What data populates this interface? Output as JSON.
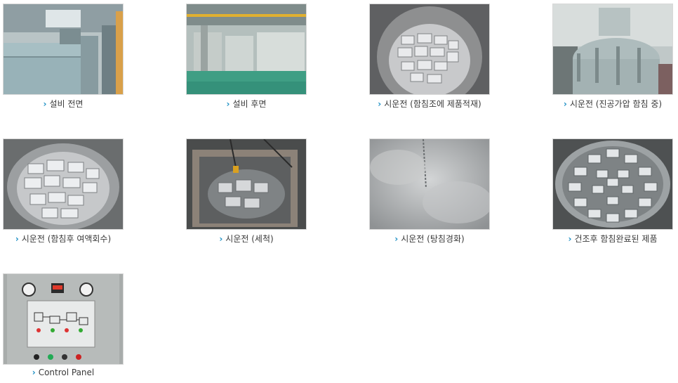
{
  "chevron_glyph": "›",
  "accent_color": "#1c8fc4",
  "gallery": [
    {
      "caption": "설비 전면",
      "image": "equipment-front-photo"
    },
    {
      "caption": "설비 후면",
      "image": "equipment-rear-photo"
    },
    {
      "caption": "시운전 (함침조에 제품적재)",
      "image": "products-loaded-in-tank-photo"
    },
    {
      "caption": "시운전 (진공가압 함침 중)",
      "image": "vacuum-pressure-impregnation-photo"
    },
    {
      "caption": "시운전 (함침후 여액회수)",
      "image": "residual-liquid-recovery-photo"
    },
    {
      "caption": "시운전 (세척)",
      "image": "washing-photo"
    },
    {
      "caption": "시운전 (탕침경화)",
      "image": "hot-water-curing-photo"
    },
    {
      "caption": "건조후 함침완료된 제품",
      "image": "finished-products-photo"
    },
    {
      "caption": "Control Panel",
      "image": "control-panel-photo"
    }
  ]
}
